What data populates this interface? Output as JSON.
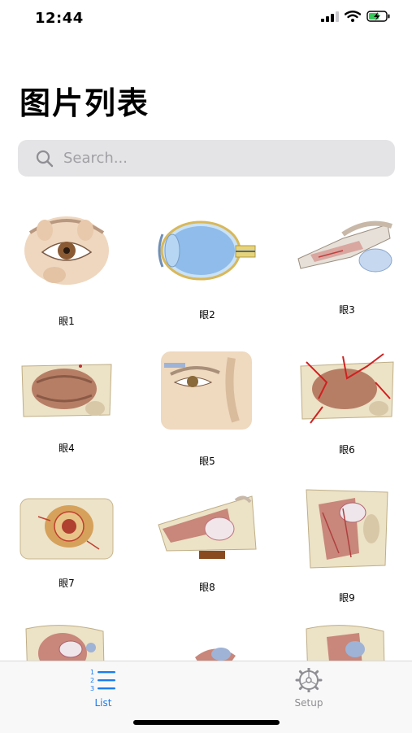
{
  "status_bar": {
    "time": "12:44"
  },
  "header": {
    "title": "图片列表"
  },
  "search": {
    "placeholder": "Search..."
  },
  "grid": {
    "items": [
      {
        "label": "眼1"
      },
      {
        "label": "眼2"
      },
      {
        "label": "眼3"
      },
      {
        "label": "眼4"
      },
      {
        "label": "眼5"
      },
      {
        "label": "眼6"
      },
      {
        "label": "眼7"
      },
      {
        "label": "眼8"
      },
      {
        "label": "眼9"
      }
    ]
  },
  "tab_bar": {
    "tabs": [
      {
        "label": "List",
        "icon": "list-icon",
        "active": true
      },
      {
        "label": "Setup",
        "icon": "gear-icon",
        "active": false
      }
    ]
  },
  "colors": {
    "accent": "#1a7cf2",
    "inactive": "#8e8e93",
    "search_bg": "#e4e4e6"
  }
}
